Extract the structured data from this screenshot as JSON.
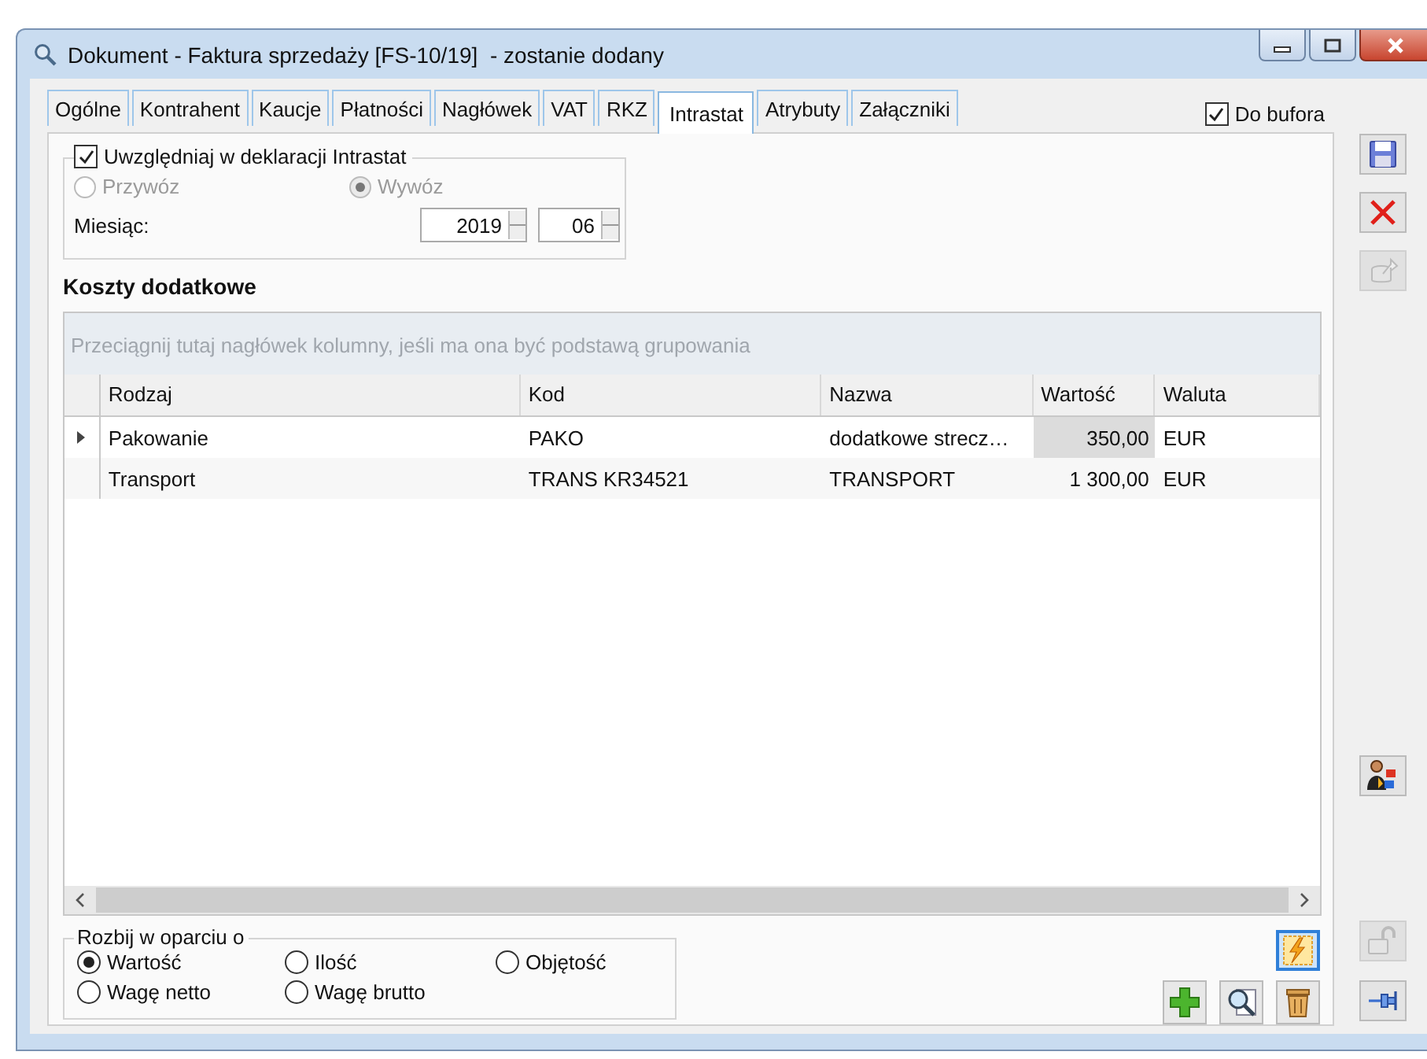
{
  "window": {
    "title": "Dokument - Faktura sprzedaży [FS-10/19]  - zostanie dodany"
  },
  "tabs": [
    {
      "label": "Ogólne",
      "selected": false
    },
    {
      "label": "Kontrahent",
      "selected": false
    },
    {
      "label": "Kaucje",
      "selected": false
    },
    {
      "label": "Płatności",
      "selected": false
    },
    {
      "label": "Nagłówek",
      "selected": false
    },
    {
      "label": "VAT",
      "selected": false
    },
    {
      "label": "RKZ",
      "selected": false
    },
    {
      "label": "Intrastat",
      "selected": true
    },
    {
      "label": "Atrybuty",
      "selected": false
    },
    {
      "label": "Załączniki",
      "selected": false
    }
  ],
  "do_bufora": {
    "label": "Do bufora",
    "checked": true
  },
  "intrastat": {
    "label": "Uwzględniaj w deklaracji Intrastat",
    "checked": true,
    "month_label": "Miesiąc:",
    "year": "2019",
    "month": "06",
    "direction": [
      {
        "label": "Przywóz",
        "selected": false,
        "disabled": true
      },
      {
        "label": "Wywóz",
        "selected": true,
        "disabled": true
      }
    ]
  },
  "costs": {
    "title": "Koszty dodatkowe",
    "group_hint": "Przeciągnij tutaj nagłówek kolumny, jeśli ma ona być podstawą grupowania",
    "columns": [
      "Rodzaj",
      "Kod",
      "Nazwa",
      "Wartość",
      "Waluta"
    ],
    "rows": [
      {
        "current": true,
        "cells": [
          {
            "text": "Pakowanie",
            "focused": false
          },
          {
            "text": "PAKO",
            "focused": false
          },
          {
            "text": "dodatkowe strecz…",
            "focused": false
          },
          {
            "text": "350,00",
            "focused": true
          },
          {
            "text": "EUR",
            "focused": false
          }
        ]
      },
      {
        "current": false,
        "cells": [
          {
            "text": "Transport",
            "focused": false
          },
          {
            "text": "TRANS KR34521",
            "focused": false
          },
          {
            "text": "TRANSPORT",
            "focused": false
          },
          {
            "text": "1 300,00",
            "focused": false
          },
          {
            "text": "EUR",
            "focused": false
          }
        ]
      }
    ]
  },
  "split": {
    "label": "Rozbij w oparciu o",
    "options": [
      {
        "label": "Wartość",
        "selected": true
      },
      {
        "label": "Ilość",
        "selected": false
      },
      {
        "label": "Objętość",
        "selected": false
      },
      {
        "label": "Wagę netto",
        "selected": false
      },
      {
        "label": "Wagę brutto",
        "selected": false
      }
    ]
  },
  "action_buttons": [
    {
      "kind": "add"
    },
    {
      "kind": "preview"
    },
    {
      "kind": "delete"
    }
  ],
  "sidebar_top": [
    {
      "kind": "save",
      "disabled": false
    },
    {
      "kind": "cancel",
      "disabled": false
    },
    {
      "kind": "export",
      "disabled": true
    }
  ],
  "sidebar_mid": [
    {
      "kind": "contractor",
      "disabled": false
    }
  ],
  "sidebar_bottom": [
    {
      "kind": "lock",
      "disabled": true
    },
    {
      "kind": "pin",
      "disabled": false
    }
  ]
}
